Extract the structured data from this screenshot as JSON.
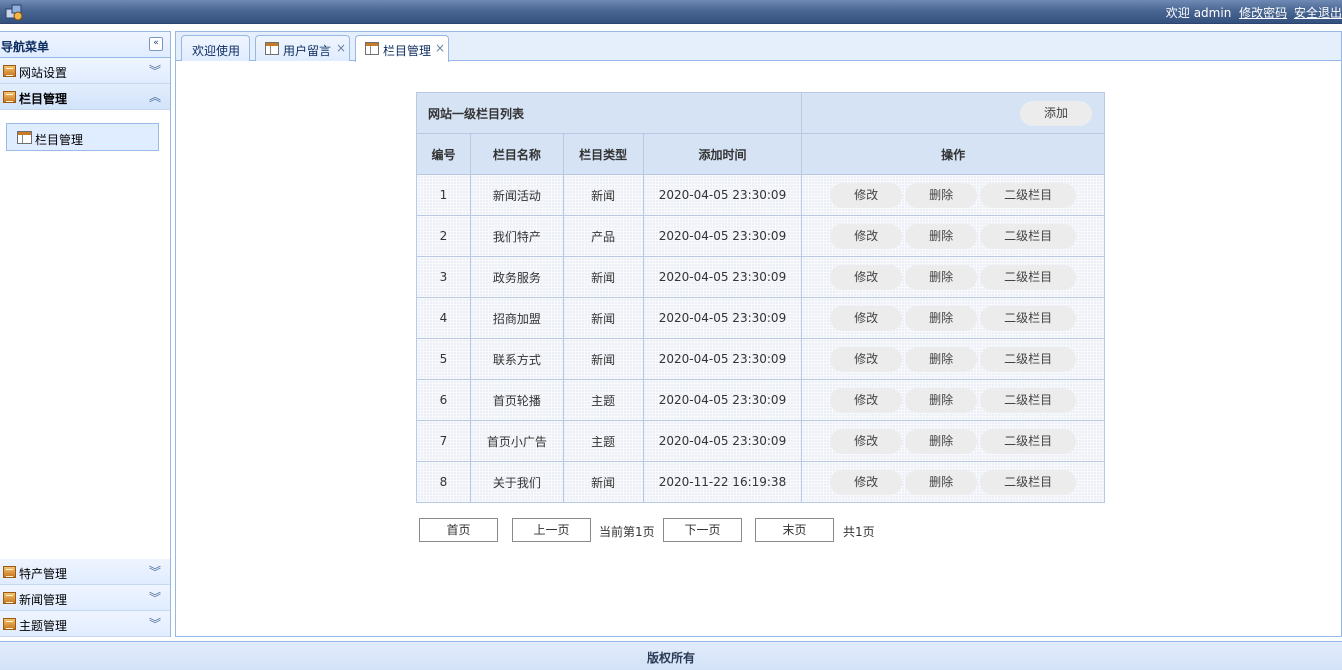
{
  "topbar": {
    "welcome": "欢迎",
    "user": "admin",
    "change_password": "修改密码",
    "logout": "安全退出"
  },
  "sidebar": {
    "title": "导航菜单",
    "sections": [
      {
        "label": "网站设置",
        "open": false
      },
      {
        "label": "栏目管理",
        "open": true,
        "items": [
          "栏目管理"
        ]
      },
      {
        "label": "特产管理",
        "open": false
      },
      {
        "label": "新闻管理",
        "open": false
      },
      {
        "label": "主题管理",
        "open": false
      }
    ]
  },
  "tabs": [
    {
      "label": "欢迎使用",
      "closable": false,
      "active": false
    },
    {
      "label": "用户留言",
      "closable": true,
      "active": false
    },
    {
      "label": "栏目管理",
      "closable": true,
      "active": true
    }
  ],
  "table": {
    "caption": "网站一级栏目列表",
    "add_label": "添加",
    "headers": [
      "编号",
      "栏目名称",
      "栏目类型",
      "添加时间",
      "操作"
    ],
    "action_labels": {
      "edit": "修改",
      "delete": "删除",
      "sub": "二级栏目"
    },
    "rows": [
      {
        "id": "1",
        "name": "新闻活动",
        "type": "新闻",
        "time": "2020-04-05 23:30:09"
      },
      {
        "id": "2",
        "name": "我们特产",
        "type": "产品",
        "time": "2020-04-05 23:30:09"
      },
      {
        "id": "3",
        "name": "政务服务",
        "type": "新闻",
        "time": "2020-04-05 23:30:09"
      },
      {
        "id": "4",
        "name": "招商加盟",
        "type": "新闻",
        "time": "2020-04-05 23:30:09"
      },
      {
        "id": "5",
        "name": "联系方式",
        "type": "新闻",
        "time": "2020-04-05 23:30:09"
      },
      {
        "id": "6",
        "name": "首页轮播",
        "type": "主题",
        "time": "2020-04-05 23:30:09"
      },
      {
        "id": "7",
        "name": "首页小广告",
        "type": "主题",
        "time": "2020-04-05 23:30:09"
      },
      {
        "id": "8",
        "name": "关于我们",
        "type": "新闻",
        "time": "2020-11-22 16:19:38"
      }
    ]
  },
  "pager": {
    "first": "首页",
    "prev": "上一页",
    "current": "当前第1页",
    "next": "下一页",
    "last": "末页",
    "total": "共1页"
  },
  "footer": {
    "text": "版权所有"
  },
  "colors": {
    "header_dark": "#34507d",
    "panel_border": "#95b8e7",
    "panel_bg": "#e0ecff",
    "table_header": "#d5e3f5"
  }
}
